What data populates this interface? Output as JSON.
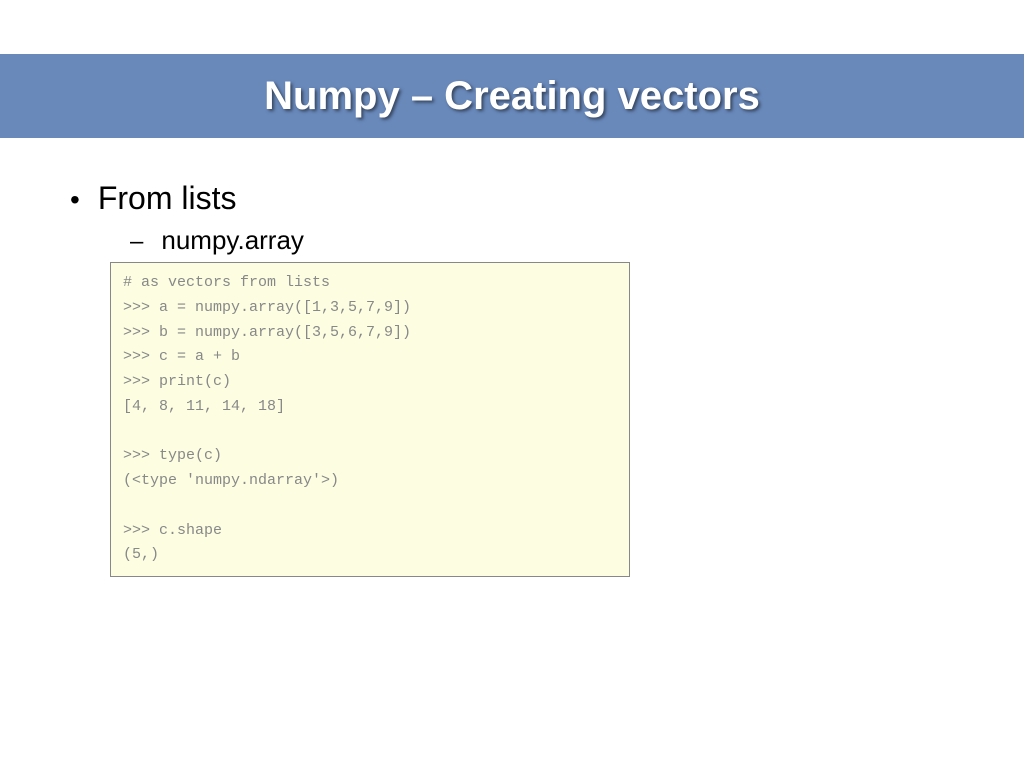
{
  "title": "Numpy – Creating vectors",
  "bullet": {
    "marker": "•",
    "text": "From lists"
  },
  "subbullet": {
    "marker": "–",
    "text": "numpy.array"
  },
  "code": "# as vectors from lists\n>>> a = numpy.array([1,3,5,7,9])\n>>> b = numpy.array([3,5,6,7,9])\n>>> c = a + b\n>>> print(c)\n[4, 8, 11, 14, 18]\n\n>>> type(c)\n(<type 'numpy.ndarray'>)\n\n>>> c.shape\n(5,)"
}
